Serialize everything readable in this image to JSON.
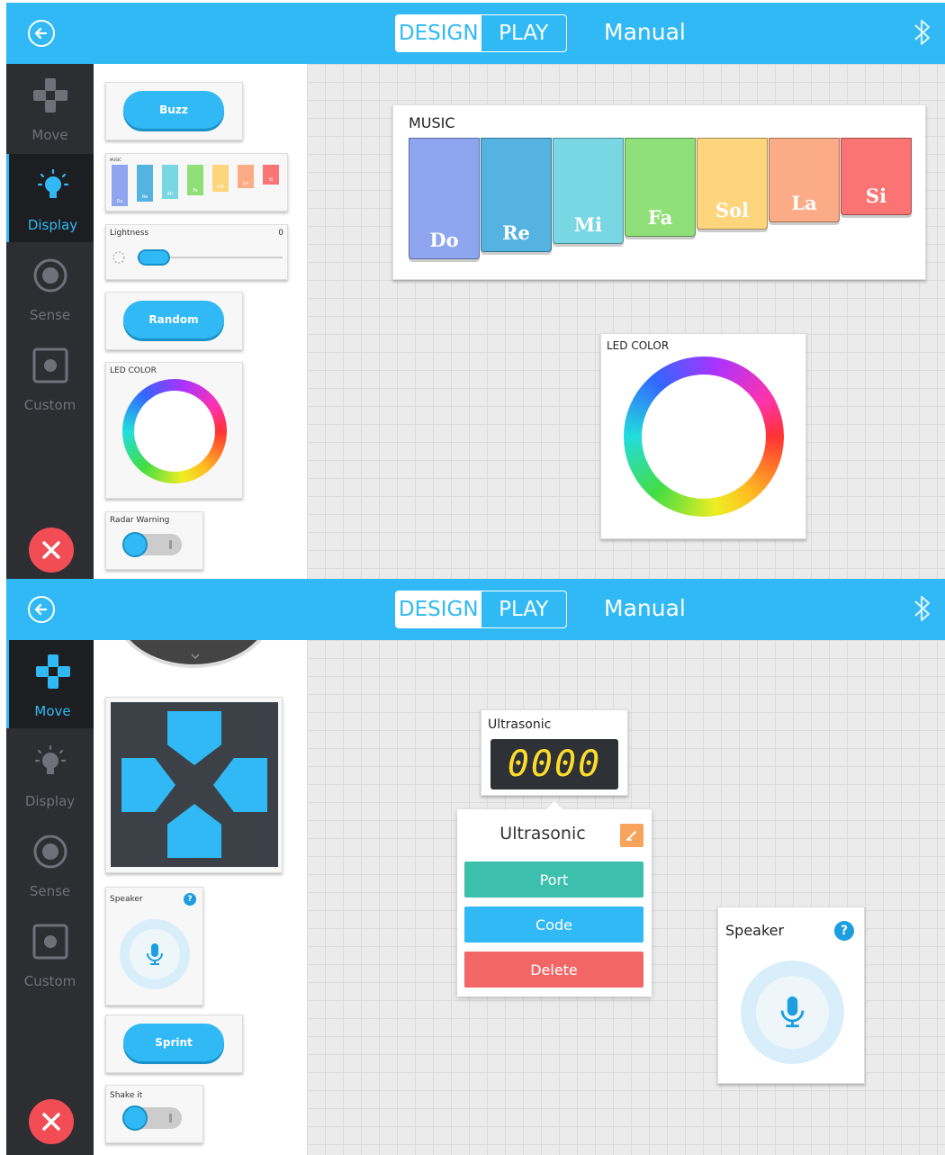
{
  "topbar": {
    "design_label": "DESIGN",
    "play_label": "PLAY",
    "mode_label": "Manual"
  },
  "nav": {
    "items": [
      {
        "label": "Move",
        "icon": "gamepad-icon"
      },
      {
        "label": "Display",
        "icon": "lightbulb-icon"
      },
      {
        "label": "Sense",
        "icon": "sense-icon"
      },
      {
        "label": "Custom",
        "icon": "custom-icon"
      }
    ]
  },
  "screen1": {
    "active_nav": "Display",
    "palette": {
      "buzz_label": "Buzz",
      "music_label": "MUSIC",
      "mini_keys": [
        "Do",
        "Re",
        "Mi",
        "Fa",
        "Sol",
        "La",
        "Si"
      ],
      "lightness_label": "Lightness",
      "lightness_value": "0",
      "random_label": "Random",
      "led_label": "LED COLOR",
      "radar_label": "Radar Warning"
    },
    "canvas": {
      "music_title": "MUSIC",
      "keys": [
        {
          "note": "Do",
          "color": "#8ea6f0"
        },
        {
          "note": "Re",
          "color": "#55b3e2"
        },
        {
          "note": "Mi",
          "color": "#78d7e3"
        },
        {
          "note": "Fa",
          "color": "#8fe079"
        },
        {
          "note": "Sol",
          "color": "#fdd57d"
        },
        {
          "note": "La",
          "color": "#fbab85"
        },
        {
          "note": "Si",
          "color": "#fb7474"
        }
      ],
      "led_title": "LED COLOR"
    }
  },
  "screen2": {
    "active_nav": "Move",
    "palette": {
      "speaker_label": "Speaker",
      "help": "?",
      "sprint_label": "Sprint",
      "shake_label": "Shake it"
    },
    "canvas": {
      "ultrasonic_title": "Ultrasonic",
      "lcd_value": "0000",
      "popup": {
        "title": "Ultrasonic",
        "port_label": "Port",
        "code_label": "Code",
        "delete_label": "Delete"
      },
      "speaker_title": "Speaker",
      "help": "?"
    }
  },
  "colors": {
    "accent": "#30b9f4",
    "close": "#f24d55",
    "port": "#3cc0ad",
    "code": "#30b9f4",
    "delete": "#f26666"
  }
}
